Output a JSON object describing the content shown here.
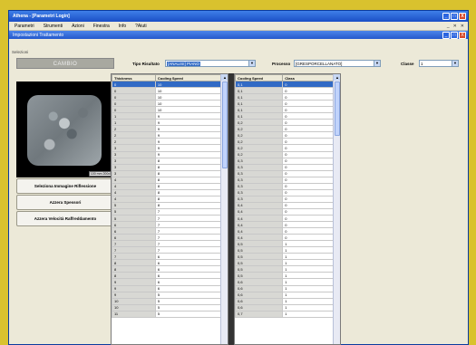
{
  "window": {
    "title": "Athena - [Parametri Login]",
    "controls": [
      "_",
      "□",
      "X"
    ]
  },
  "menu": {
    "items": [
      "Parametri",
      "Strumenti",
      "Azioni",
      "Finestra",
      "Info",
      "?Aiuti"
    ],
    "mdi_controls": [
      "_",
      "✕",
      "✕"
    ]
  },
  "child": {
    "title": "Impostazioni Trattamento",
    "controls": [
      "_",
      "□",
      "X"
    ]
  },
  "selection_label": "Selezioni",
  "cambio_label": "CAMBIO",
  "filters": {
    "tipo_label": "Tipo Risultato",
    "tipo_value": "[ANALISI] PIANO",
    "processo_label": "Processo",
    "processo_value": "[GRESPORCELLANATO]",
    "classe_label": "Classe",
    "classe_value": "1"
  },
  "image": {
    "zoom_tag": "100 mm 200x0"
  },
  "actions": [
    "Seleziona Immagine Riflessione",
    "Azzera Spessori",
    "Azzera Velocità Raffreddamento"
  ],
  "grid1": {
    "headers": [
      "Thickness",
      "Cooling Speed"
    ],
    "rows": [
      [
        "0",
        "10"
      ],
      [
        "0",
        "10"
      ],
      [
        "0",
        "10"
      ],
      [
        "0",
        "10"
      ],
      [
        "0",
        "10"
      ],
      [
        "1",
        "9"
      ],
      [
        "1",
        "9"
      ],
      [
        "2",
        "9"
      ],
      [
        "2",
        "9"
      ],
      [
        "2",
        "9"
      ],
      [
        "3",
        "9"
      ],
      [
        "3",
        "9"
      ],
      [
        "3",
        "8"
      ],
      [
        "3",
        "8"
      ],
      [
        "3",
        "8"
      ],
      [
        "4",
        "8"
      ],
      [
        "4",
        "8"
      ],
      [
        "4",
        "8"
      ],
      [
        "4",
        "8"
      ],
      [
        "5",
        "8"
      ],
      [
        "5",
        "7"
      ],
      [
        "5",
        "7"
      ],
      [
        "6",
        "7"
      ],
      [
        "6",
        "7"
      ],
      [
        "6",
        "7"
      ],
      [
        "7",
        "7"
      ],
      [
        "7",
        "7"
      ],
      [
        "7",
        "6"
      ],
      [
        "8",
        "6"
      ],
      [
        "8",
        "6"
      ],
      [
        "8",
        "6"
      ],
      [
        "9",
        "6"
      ],
      [
        "9",
        "6"
      ],
      [
        "9",
        "5"
      ],
      [
        "10",
        "5"
      ],
      [
        "10",
        "5"
      ],
      [
        "11",
        "5"
      ]
    ]
  },
  "grid2": {
    "headers": [
      "Cooling Speed",
      "Class"
    ],
    "rows": [
      [
        "0,1",
        "0"
      ],
      [
        "0,1",
        "0"
      ],
      [
        "0,1",
        "0"
      ],
      [
        "0,1",
        "0"
      ],
      [
        "0,1",
        "0"
      ],
      [
        "0,1",
        "0"
      ],
      [
        "0,2",
        "0"
      ],
      [
        "0,2",
        "0"
      ],
      [
        "0,2",
        "0"
      ],
      [
        "0,2",
        "0"
      ],
      [
        "0,2",
        "0"
      ],
      [
        "0,2",
        "0"
      ],
      [
        "0,3",
        "0"
      ],
      [
        "0,3",
        "0"
      ],
      [
        "0,3",
        "0"
      ],
      [
        "0,3",
        "0"
      ],
      [
        "0,3",
        "0"
      ],
      [
        "0,3",
        "0"
      ],
      [
        "0,3",
        "0"
      ],
      [
        "0,4",
        "0"
      ],
      [
        "0,4",
        "0"
      ],
      [
        "0,4",
        "0"
      ],
      [
        "0,4",
        "0"
      ],
      [
        "0,4",
        "0"
      ],
      [
        "0,4",
        "0"
      ],
      [
        "0,5",
        "1"
      ],
      [
        "0,5",
        "1"
      ],
      [
        "0,5",
        "1"
      ],
      [
        "0,5",
        "1"
      ],
      [
        "0,5",
        "1"
      ],
      [
        "0,5",
        "1"
      ],
      [
        "0,6",
        "1"
      ],
      [
        "0,6",
        "1"
      ],
      [
        "0,6",
        "1"
      ],
      [
        "0,6",
        "1"
      ],
      [
        "0,6",
        "1"
      ],
      [
        "0,7",
        "1"
      ]
    ]
  }
}
